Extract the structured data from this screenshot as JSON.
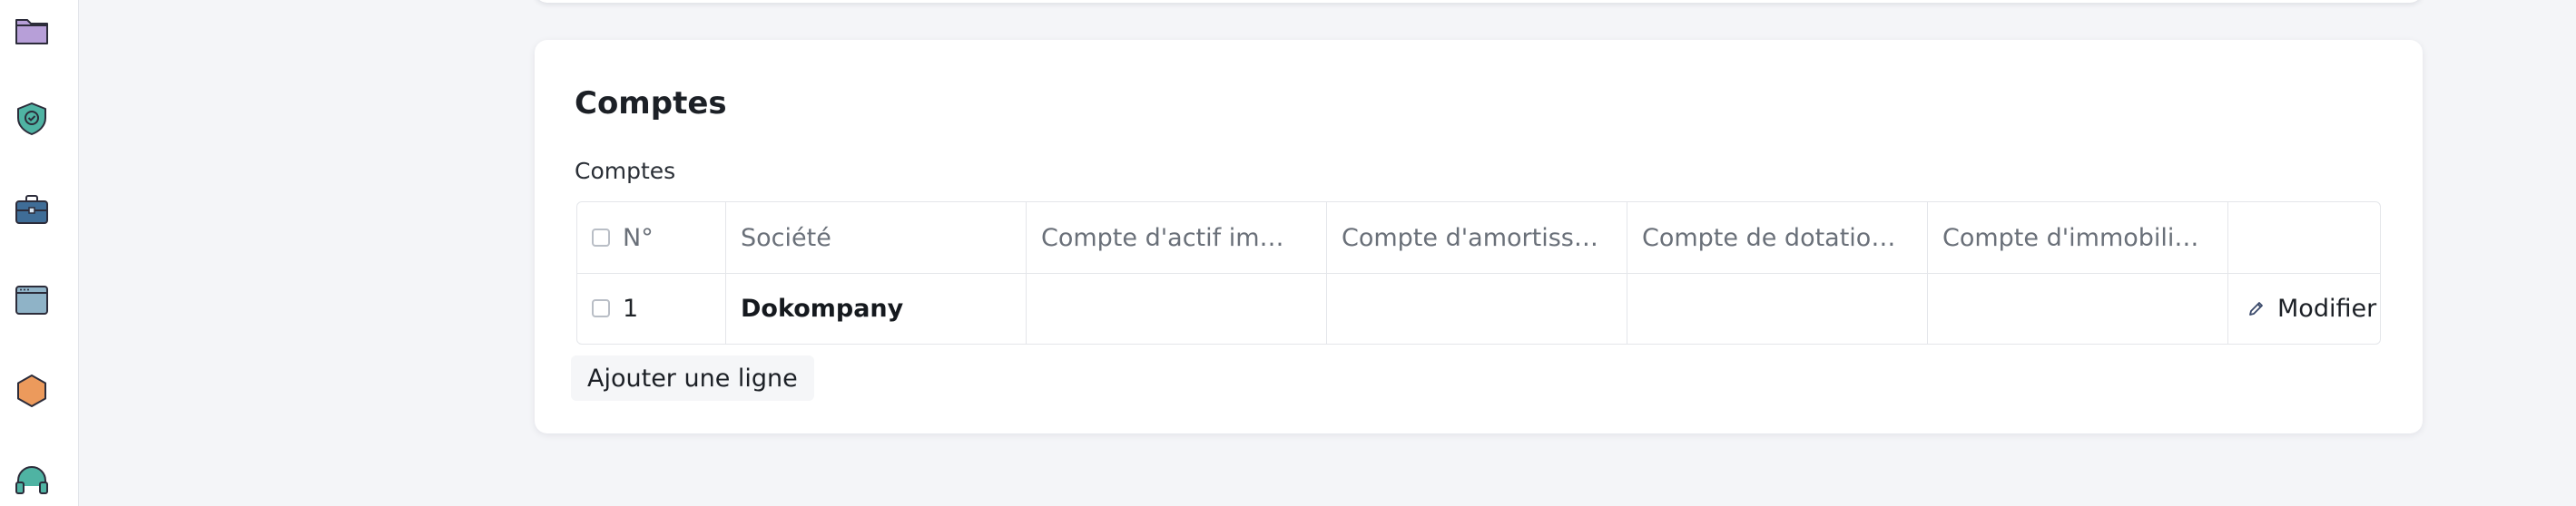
{
  "sidebar": {
    "icons": [
      {
        "name": "folder-icon",
        "color": "#b79fd8"
      },
      {
        "name": "shield-check-icon",
        "color": "#4fb3a3"
      },
      {
        "name": "briefcase-icon",
        "color": "#3f6d97"
      },
      {
        "name": "browser-window-icon",
        "color": "#8fb3c7"
      },
      {
        "name": "hexagon-icon",
        "color": "#ec9a5c"
      },
      {
        "name": "headset-icon",
        "color": "#4fb3a3"
      }
    ]
  },
  "card": {
    "title": "Comptes",
    "section_label": "Comptes",
    "table": {
      "columns": [
        "N°",
        "Société",
        "Compte d'actif imm...",
        "Compte d'amortisse...",
        "Compte de dotation...",
        "Compte d'immobilis...",
        ""
      ],
      "rows": [
        {
          "number": "1",
          "societe": "Dokompany",
          "compte_actif": "",
          "compte_amortissement": "",
          "compte_dotation": "",
          "compte_immobilisation": "",
          "action": "Modifier"
        }
      ]
    },
    "add_line_label": "Ajouter une ligne"
  }
}
